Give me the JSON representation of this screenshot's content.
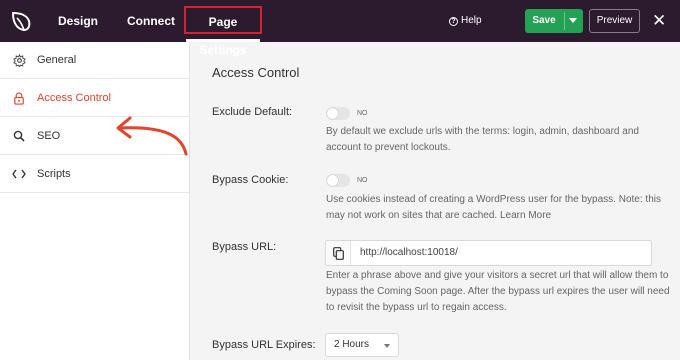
{
  "topbar": {
    "logo_icon": "seedprod-leaf-icon",
    "tabs": [
      {
        "label": "Design"
      },
      {
        "label": "Connect"
      },
      {
        "label": "Page Settings"
      }
    ],
    "help_label": "Help",
    "save_label": "Save",
    "preview_label": "Preview",
    "close_label": "✕"
  },
  "sidebar": {
    "items": [
      {
        "label": "General",
        "icon": "gear-icon"
      },
      {
        "label": "Access Control",
        "icon": "lock-icon"
      },
      {
        "label": "SEO",
        "icon": "search-icon"
      },
      {
        "label": "Scripts",
        "icon": "code-icon"
      }
    ],
    "active_index": 1
  },
  "main": {
    "title": "Access Control",
    "exclude_default": {
      "label": "Exclude Default:",
      "toggle_state": "NO",
      "help": "By default we exclude urls with the terms: login, admin, dashboard and account to prevent lockouts."
    },
    "bypass_cookie": {
      "label": "Bypass Cookie:",
      "toggle_state": "NO",
      "help": "Use cookies instead of creating a WordPress user for the bypass. Note: this may not work on sites that are cached. Learn More"
    },
    "bypass_url": {
      "label": "Bypass URL:",
      "value": "http://localhost:10018/",
      "help": "Enter a phrase above and give your visitors a secret url that will allow them to bypass the Coming Soon page. After the bypass url expires the user will need to revisit the bypass url to regain access."
    },
    "bypass_url_expires": {
      "label": "Bypass URL Expires:",
      "value": "2 Hours"
    }
  },
  "colors": {
    "topbar_bg": "#2c1a2e",
    "save_green": "#24a155",
    "highlight_red": "#d6242e",
    "active_item": "#e2442c"
  }
}
